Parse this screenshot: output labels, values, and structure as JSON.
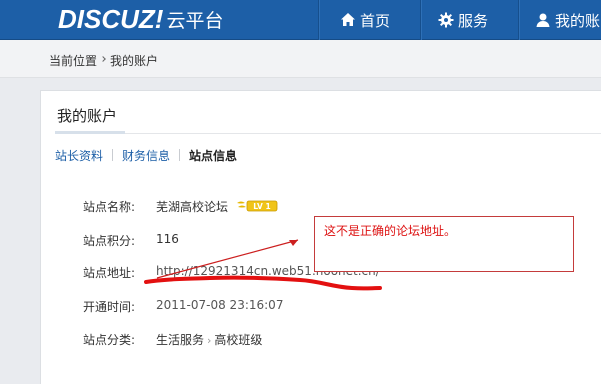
{
  "header": {
    "logo_main": "DISCUZ!",
    "logo_sub": "云平台",
    "nav": [
      {
        "label": "首页",
        "icon": "home-icon"
      },
      {
        "label": "服务",
        "icon": "gear-icon"
      },
      {
        "label": "我的账",
        "icon": "user-icon"
      }
    ]
  },
  "breadcrumb": {
    "prefix": "当前位置",
    "current": "我的账户"
  },
  "page": {
    "title": "我的账户",
    "tabs": [
      {
        "label": "站长资料",
        "active": false
      },
      {
        "label": "财务信息",
        "active": false
      },
      {
        "label": "站点信息",
        "active": true
      }
    ]
  },
  "site_info": {
    "name_label": "站点名称:",
    "name_value": "芜湖高校论坛",
    "level_badge": "LV 1",
    "points_label": "站点积分:",
    "points_value": "116",
    "url_label": "站点地址:",
    "url_value": "http://12921314cn.web51.noonet.cn/",
    "opened_label": "开通时间:",
    "opened_value": "2011-07-08 23:16:07",
    "category_label": "站点分类:",
    "category_main": "生活服务",
    "category_sub": "高校班级"
  },
  "annotation": {
    "text": "这不是正确的论坛地址。",
    "color": "#dd1111"
  },
  "colors": {
    "header_bg": "#1d5fa7",
    "link": "#1d5fa7",
    "annotation_red": "#dd1111"
  }
}
